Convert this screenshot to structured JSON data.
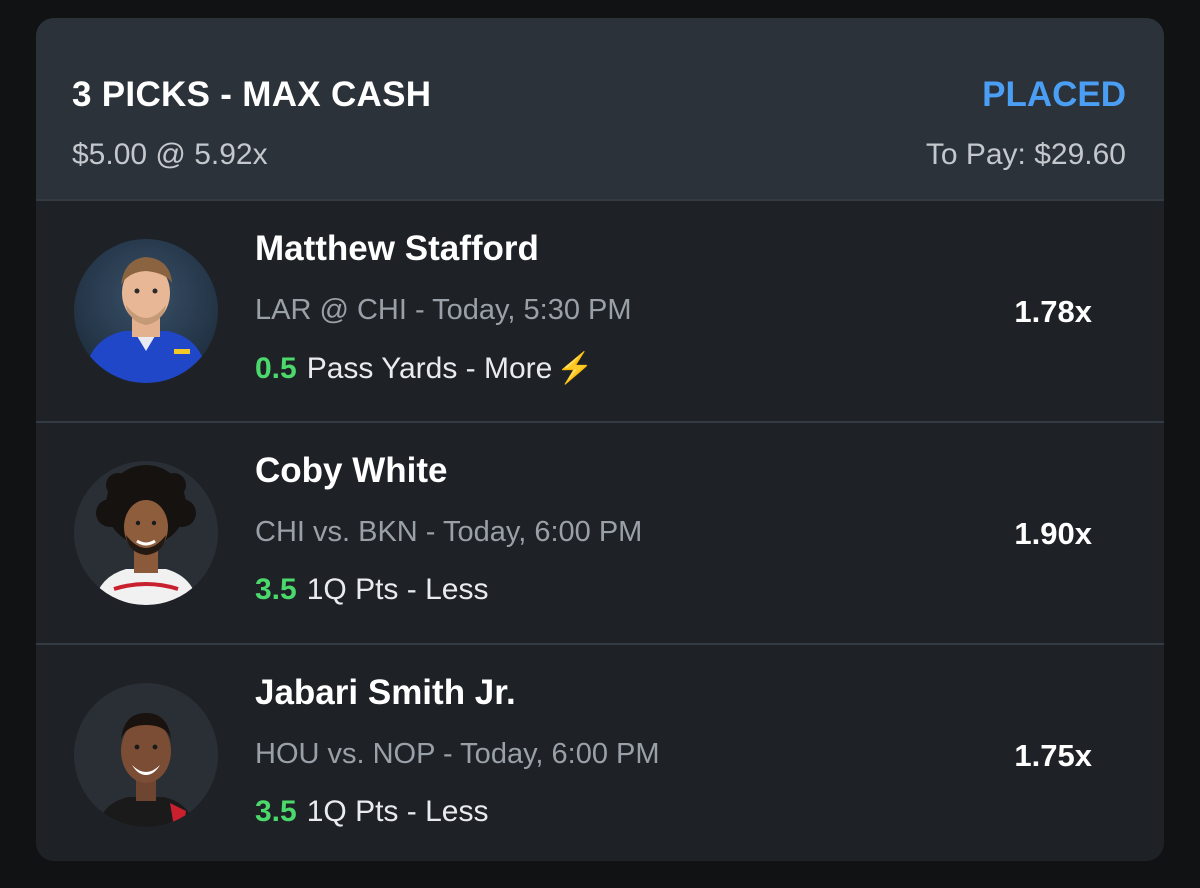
{
  "header": {
    "title": "3 PICKS - MAX CASH",
    "status": "PLACED",
    "stake": "$5.00 @ 5.92x",
    "to_pay": "To Pay: $29.60"
  },
  "picks": [
    {
      "name": "Matthew Stafford",
      "matchup": "LAR @ CHI",
      "time": " - Today, 5:30 PM",
      "line_value": "0.5",
      "line_text": "Pass Yards - More",
      "boost_icon": "lightning-bolt-icon",
      "boost_glyph": "⚡",
      "multiplier": "1.78x"
    },
    {
      "name": "Coby White",
      "matchup": "CHI vs. BKN",
      "time": " - Today, 6:00 PM",
      "line_value": "3.5",
      "line_text": "1Q Pts - Less",
      "multiplier": "1.90x"
    },
    {
      "name": "Jabari Smith Jr.",
      "matchup": "HOU vs. NOP",
      "time": " - Today, 6:00 PM",
      "line_value": "3.5",
      "line_text": "1Q Pts - Less",
      "multiplier": "1.75x"
    }
  ],
  "colors": {
    "background": "#111214",
    "card": "#1e2227",
    "header": "#2c323a",
    "placed": "#4a9ff5",
    "line_value": "#4cd96b"
  }
}
